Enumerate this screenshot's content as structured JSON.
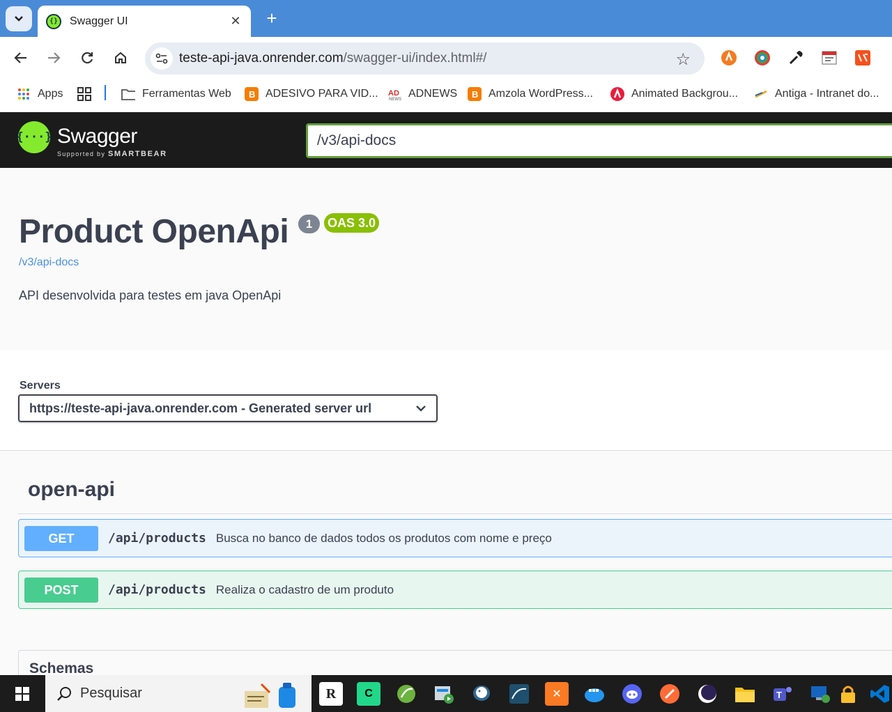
{
  "browser": {
    "tab_title": "Swagger UI",
    "url_domain": "teste-api-java.onrender.com",
    "url_path": "/swagger-ui/index.html#/",
    "bookmarks": [
      {
        "label": "Apps"
      },
      {
        "label": "Ferramentas Web"
      },
      {
        "label": "ADESIVO PARA VID..."
      },
      {
        "label": "ADNEWS"
      },
      {
        "label": "Amzola WordPress..."
      },
      {
        "label": "Animated Backgrou..."
      },
      {
        "label": "Antiga - Intranet do..."
      }
    ],
    "icons": {
      "tab_search": "chevron-down-icon",
      "back": "arrow-left-icon",
      "forward": "arrow-right-icon",
      "reload": "reload-icon",
      "home": "home-icon",
      "bookmark": "star-icon"
    }
  },
  "swagger": {
    "logo_text": "Swagger",
    "logo_sub_prefix": "Supported by",
    "logo_sub_brand": "SMARTBEAR",
    "spec_url": "/v3/api-docs",
    "title": "Product OpenApi",
    "version": "1",
    "oas_badge": "OAS 3.0",
    "api_docs_link": "/v3/api-docs",
    "description": "API desenvolvida para testes em java OpenApi",
    "servers_label": "Servers",
    "selected_server": "https://teste-api-java.onrender.com - Generated server url",
    "tag_name": "open-api",
    "operations": [
      {
        "method": "GET",
        "path": "/api/products",
        "summary": "Busca no banco de dados todos os produtos com nome e preço",
        "color": "#61affe"
      },
      {
        "method": "POST",
        "path": "/api/products",
        "summary": "Realiza o cadastro de um produto",
        "color": "#49cc90"
      }
    ],
    "schemas_label": "Schemas",
    "colors": {
      "accent": "#85ea2d",
      "header_bg": "#1b1b1b",
      "link": "#4990e2"
    }
  },
  "taskbar": {
    "search_placeholder": "Pesquisar",
    "apps": [
      "rstudio-icon",
      "pycharm-icon",
      "spring-icon",
      "media-icon",
      "postgres-icon",
      "mysql-workbench-icon",
      "xampp-icon",
      "docker-icon",
      "discord-icon",
      "postman-icon",
      "eclipse-icon",
      "file-explorer-icon",
      "teams-icon",
      "remote-desktop-icon",
      "lock-icon",
      "vscode-icon"
    ]
  }
}
